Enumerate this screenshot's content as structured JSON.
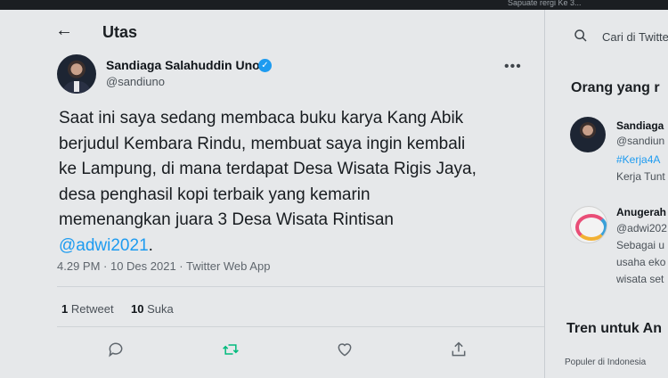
{
  "browser": {
    "tab_text": "Sapuate rergi Ke 3..."
  },
  "header": {
    "back_icon": "arrow-left-icon",
    "title": "Utas"
  },
  "tweet": {
    "author_name": "Sandiaga Salahuddin Uno",
    "handle": "@sandiuno",
    "verified": true,
    "text_lines": [
      "Saat ini saya sedang membaca buku karya Kang Abik",
      "berjudul Kembara Rindu, membuat saya ingin kembali",
      "ke Lampung, di mana terdapat Desa Wisata Rigis Jaya,",
      "desa penghasil kopi terbaik yang kemarin",
      "memenangkan juara 3 Desa Wisata Rintisan"
    ],
    "mention": "@adwi2021",
    "mention_suffix": ".",
    "timestamp": "4.29 PM · 10 Des 2021 · Twitter Web App",
    "retweets_count": "1",
    "retweets_label": "Retweet",
    "likes_count": "10",
    "likes_label": "Suka",
    "actions": [
      "reply-icon",
      "retweet-icon",
      "like-icon",
      "share-icon"
    ]
  },
  "sidebar": {
    "search_placeholder": "Cari di Twitte",
    "people_heading": "Orang yang r",
    "people": [
      {
        "name": "Sandiaga",
        "handle": "@sandiun",
        "extra1": "#Kerja4A",
        "extra2": "Kerja Tunt"
      },
      {
        "name": "Anugerah",
        "handle": "@adwi202",
        "extra1": "Sebagai u",
        "extra2": "usaha eko",
        "extra3": "wisata set"
      }
    ],
    "trends_heading": "Tren untuk An",
    "trend_category": "Populer di Indonesia"
  },
  "colors": {
    "accent": "#1d9bf0",
    "retweet_green": "#00ba7c"
  }
}
